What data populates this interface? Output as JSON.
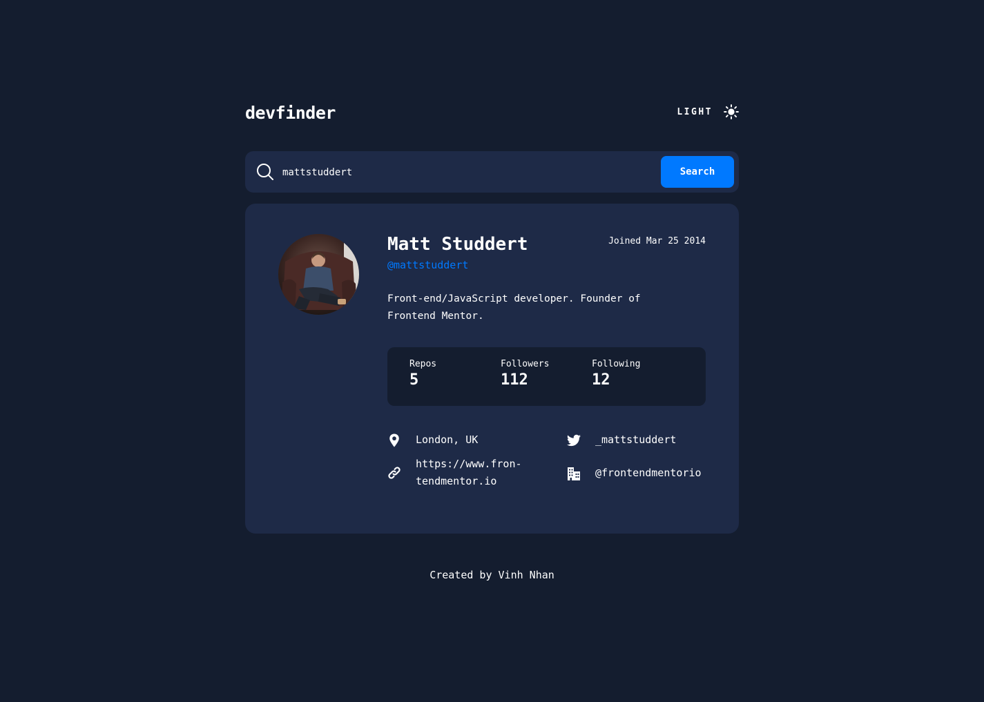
{
  "app": {
    "logo": "devfinder",
    "theme_label": "LIGHT"
  },
  "search": {
    "value": "mattstuddert",
    "button_label": "Search"
  },
  "profile": {
    "name": "Matt Studdert",
    "login": "@mattstuddert",
    "joined": "Joined Mar 25 2014",
    "bio_line1": "Front-end/JavaScript developer. Founder of",
    "bio_line2": "Frontend Mentor."
  },
  "stats": {
    "repos_label": "Repos",
    "repos_value": "5",
    "followers_label": "Followers",
    "followers_value": "112",
    "following_label": "Following",
    "following_value": "12"
  },
  "links": {
    "location": "London, UK",
    "twitter": "_mattstuddert",
    "blog_line1": "https://www.fron-",
    "blog_line2": "tendmentor.io",
    "company": "@frontendmentorio"
  },
  "footer": {
    "credit": "Created by Vinh Nhan"
  },
  "colors": {
    "background": "#141d2f",
    "card": "#1e2a47",
    "accent": "#0079ff",
    "text": "#ffffff"
  },
  "icons": {
    "theme": "sun-icon",
    "search": "search-icon",
    "location": "location-pin-icon",
    "twitter": "twitter-icon",
    "website": "link-icon",
    "company": "company-building-icon"
  }
}
